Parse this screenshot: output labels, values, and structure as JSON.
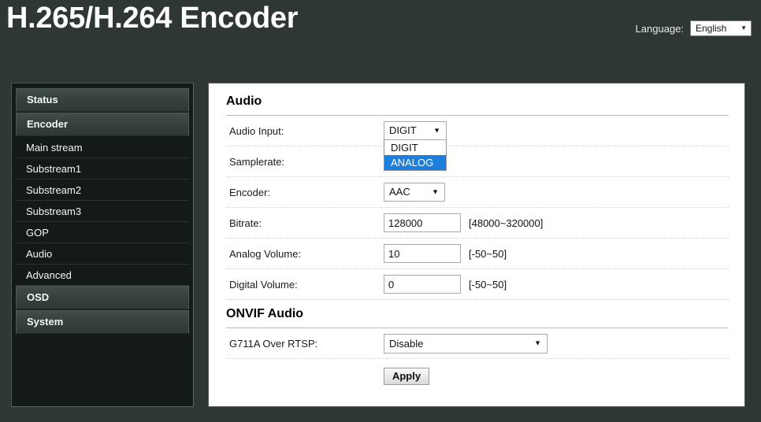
{
  "header": {
    "title": "H.265/H.264 Encoder",
    "language_label": "Language:",
    "language_value": "English",
    "caret": "▼"
  },
  "sidebar": {
    "items": [
      {
        "label": "Status",
        "type": "head"
      },
      {
        "label": "Encoder",
        "type": "head"
      },
      {
        "label": "Main stream",
        "type": "sub"
      },
      {
        "label": "Substream1",
        "type": "sub"
      },
      {
        "label": "Substream2",
        "type": "sub"
      },
      {
        "label": "Substream3",
        "type": "sub"
      },
      {
        "label": "GOP",
        "type": "sub"
      },
      {
        "label": "Audio",
        "type": "sub"
      },
      {
        "label": "Advanced",
        "type": "sub"
      },
      {
        "label": "OSD",
        "type": "head"
      },
      {
        "label": "System",
        "type": "head"
      }
    ]
  },
  "main": {
    "audio_section_title": "Audio",
    "onvif_section_title": "ONVIF Audio",
    "rows": {
      "audio_input": {
        "label": "Audio Input:",
        "value": "DIGIT",
        "options": [
          "DIGIT",
          "ANALOG"
        ],
        "selected_option": "ANALOG",
        "open": true
      },
      "samplerate": {
        "label": "Samplerate:"
      },
      "encoder": {
        "label": "Encoder:",
        "value": "AAC"
      },
      "bitrate": {
        "label": "Bitrate:",
        "value": "128000",
        "hint": "[48000~320000]"
      },
      "analog_volume": {
        "label": "Analog Volume:",
        "value": "10",
        "hint": "[-50~50]"
      },
      "digital_volume": {
        "label": "Digital Volume:",
        "value": "0",
        "hint": "[-50~50]"
      },
      "g711a_over_rtsp": {
        "label": "G711A Over RTSP:",
        "value": "Disable"
      }
    },
    "apply_label": "Apply",
    "caret": "▼"
  },
  "colors": {
    "page_background": "#2e3735",
    "panel_white": "#ffffff",
    "sidebar_background": "#141a19",
    "highlight_blue": "#1c7fdd"
  }
}
